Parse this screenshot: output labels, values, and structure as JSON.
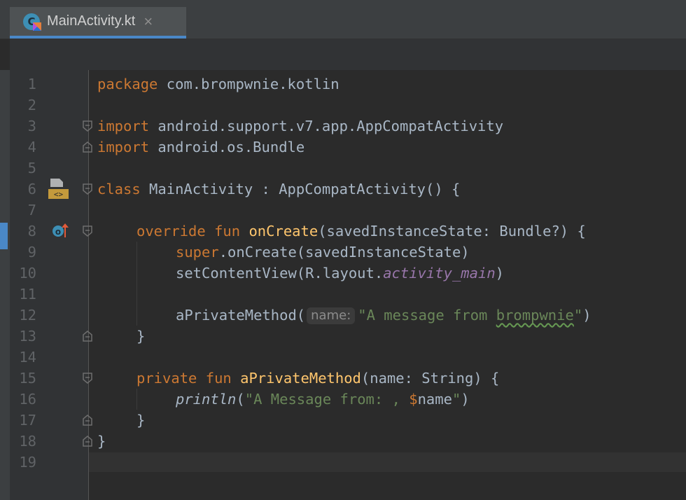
{
  "tab": {
    "file_name": "MainActivity.kt",
    "close_glyph": "×",
    "icon": "kotlin-class-icon"
  },
  "editor": {
    "lines": [
      {
        "num": "1"
      },
      {
        "num": "2"
      },
      {
        "num": "3"
      },
      {
        "num": "4"
      },
      {
        "num": "5"
      },
      {
        "num": "6"
      },
      {
        "num": "7"
      },
      {
        "num": "8"
      },
      {
        "num": "9"
      },
      {
        "num": "10"
      },
      {
        "num": "11"
      },
      {
        "num": "12"
      },
      {
        "num": "13"
      },
      {
        "num": "14"
      },
      {
        "num": "15"
      },
      {
        "num": "16"
      },
      {
        "num": "17"
      },
      {
        "num": "18"
      },
      {
        "num": "19"
      }
    ],
    "tokens": {
      "package_kw": "package",
      "package_name": " com.brompwnie.kotlin",
      "import_kw": "import",
      "import1": " android.support.v7.app.AppCompatActivity",
      "import2": " android.os.Bundle",
      "class_kw": "class",
      "class_decl": " MainActivity : AppCompatActivity() {",
      "override_kw": "override fun ",
      "oncreate_fn": "onCreate",
      "oncreate_params": "(savedInstanceState: Bundle?) {",
      "super_kw": "super",
      "super_call": ".onCreate(savedInstanceState)",
      "setcontent_a": "setContentView(R.layout.",
      "activity_main": "activity_main",
      "setcontent_b": ")",
      "apriv_call": "aPrivateMethod(",
      "hint_name": "name:",
      "msg_str_a": "\"A message from ",
      "msg_str_b": "brompwnie",
      "msg_str_c": "\"",
      "close_paren": ")",
      "brace_close": "}",
      "private_kw": "private fun ",
      "apriv_fn": "aPrivateMethod",
      "apriv_params": "(name: String) {",
      "println_fn": "println",
      "println_open": "(",
      "println_str": "\"A Message from: , ",
      "dollar": "$",
      "name_ref": "name",
      "println_end_str": "\"",
      "println_close": ")"
    }
  },
  "colors": {
    "keyword": "#cc7832",
    "function": "#ffc66d",
    "string": "#6a8759",
    "property": "#9876aa",
    "text": "#a9b7c6",
    "selected_tab_underline": "#4a88c7"
  }
}
